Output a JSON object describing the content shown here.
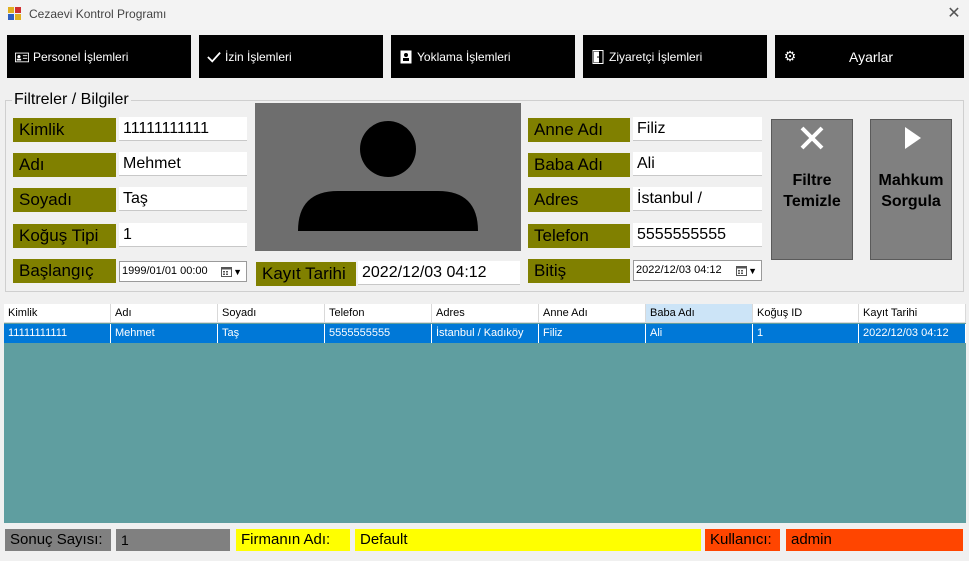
{
  "window": {
    "title": "Cezaevi Kontrol Programı",
    "close": "✕"
  },
  "menu": {
    "personel": "Personel İşlemleri",
    "izin": "İzin İşlemleri",
    "yoklama": "Yoklama İşlemleri",
    "ziyaretci": "Ziyaretçi İşlemleri",
    "ayarlar": "Ayarlar"
  },
  "filters": {
    "group_title": "Filtreler / Bilgiler",
    "kimlik_label": "Kimlik",
    "kimlik_value": "11111111111",
    "adi_label": "Adı",
    "adi_value": "Mehmet",
    "soyadi_label": "Soyadı",
    "soyadi_value": "Taş",
    "kogus_label": "Koğuş Tipi",
    "kogus_value": "1",
    "baslangic_label": "Başlangıç",
    "baslangic_value": "1999/01/01 00:00",
    "kayit_label": "Kayıt Tarihi",
    "kayit_value": "2022/12/03 04:12",
    "anne_label": "Anne Adı",
    "anne_value": "Filiz",
    "baba_label": "Baba Adı",
    "baba_value": "Ali",
    "adres_label": "Adres",
    "adres_value": "İstanbul /",
    "telefon_label": "Telefon",
    "telefon_value": "5555555555",
    "bitis_label": "Bitiş",
    "bitis_value": "2022/12/03 04:12"
  },
  "buttons": {
    "filtre_temizle_1": "Filtre",
    "filtre_temizle_2": "Temizle",
    "mahkum_sorgula_1": "Mahkum",
    "mahkum_sorgula_2": "Sorgula"
  },
  "grid": {
    "headers": [
      "Kimlik",
      "Adı",
      "Soyadı",
      "Telefon",
      "Adres",
      "Anne Adı",
      "Baba Adı",
      "Koğuş ID",
      "Kayıt Tarihi"
    ],
    "rows": [
      [
        "11111111111",
        "Mehmet",
        "Taş",
        "5555555555",
        "İstanbul / Kadıköy",
        "Filiz",
        "Ali",
        "1",
        "2022/12/03 04:12"
      ]
    ]
  },
  "status": {
    "sonuc_label": "Sonuç Sayısı:",
    "sonuc_value": "1",
    "firma_label": "Firmanın Adı:",
    "firma_value": "Default",
    "kullanici_label": "Kullanıcı:",
    "kullanici_value": "admin"
  },
  "colors": {
    "label_bg": "#808000",
    "grid_bg": "#5f9ea0",
    "row_selected": "#0078d7",
    "firma_bg": "#ffff00",
    "kullanici_bg": "#ff4500",
    "menu_bg": "#000000"
  }
}
